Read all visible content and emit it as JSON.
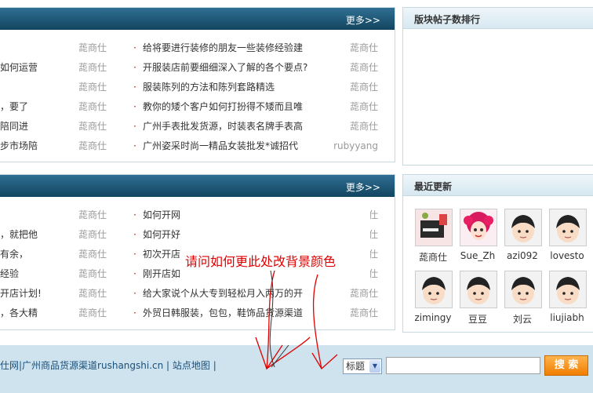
{
  "top_panel": {
    "more_label": "更多>>",
    "rows": [
      {
        "left_text": "",
        "left_author": "蒊商仕",
        "title": "给将要进行装修的朋友一些装修经验建",
        "author": "蒊商仕"
      },
      {
        "left_text": "如何运营",
        "left_author": "蒊商仕",
        "title": "开服装店前要细细深入了解的各个要点?",
        "author": "蒊商仕"
      },
      {
        "left_text": "",
        "left_author": "蒊商仕",
        "title": "服装陈列的方法和陈列套路精选",
        "author": "蒊商仕"
      },
      {
        "left_text": "，要了",
        "left_author": "蒊商仕",
        "title": "教你的矮个客户如何打扮得不矮而且唯",
        "author": "蒊商仕"
      },
      {
        "left_text": "陪同进",
        "left_author": "蒊商仕",
        "title": "广州手表批发货源，时装表名牌手表高",
        "author": "蒊商仕"
      },
      {
        "left_text": "步市场陪",
        "left_author": "蒊商仕",
        "title": "广州姿采时尚一精品女装批发*诚招代",
        "author": "rubyyang"
      }
    ]
  },
  "bottom_panel": {
    "more_label": "更多>>",
    "rows": [
      {
        "left_text": "",
        "left_author": "蒊商仕",
        "title": "如何开网",
        "author": "仕"
      },
      {
        "left_text": "，就把他",
        "left_author": "蒊商仕",
        "title": "如何开好",
        "author": "仕"
      },
      {
        "left_text": "有余，",
        "left_author": "蒊商仕",
        "title": "初次开店",
        "author": "仕"
      },
      {
        "left_text": "经验",
        "left_author": "蒊商仕",
        "title": "刚开店如",
        "author": "仕"
      },
      {
        "left_text": "开店计划!",
        "left_author": "蒊商仕",
        "title": "给大家说个从大专到轻松月入两万的开",
        "author": "蒊商仕"
      },
      {
        "left_text": "，各大精",
        "left_author": "蒊商仕",
        "title": "外贸日韩服装，包包，鞋饰品货源渠道",
        "author": "蒊商仕"
      }
    ]
  },
  "ranking_panel": {
    "title": "版块帖子数排行"
  },
  "recent_panel": {
    "title": "最近更新",
    "users": [
      {
        "name": "蒊商仕",
        "avatar": "photo-avatar"
      },
      {
        "name": "Sue_Zh",
        "avatar": "cartoon-girl-avatar"
      },
      {
        "name": "azi092",
        "avatar": "default-avatar"
      },
      {
        "name": "lovesto",
        "avatar": "default-avatar"
      },
      {
        "name": "zimingy",
        "avatar": "default-avatar"
      },
      {
        "name": "豆豆",
        "avatar": "default-avatar"
      },
      {
        "name": "刘云",
        "avatar": "default-avatar"
      },
      {
        "name": "liujiabh",
        "avatar": "default-avatar"
      }
    ]
  },
  "footer": {
    "links_text": "仕网|广州商品货源渠道rushangshi.cn  |  站点地图  |",
    "select_value": "标题",
    "search_button": "搜 索"
  },
  "annotation": {
    "text": "请问如何更此处改背景颜色"
  },
  "colors": {
    "header_dark": "#1a4f6e",
    "accent_red": "#e00000",
    "footer_bg": "#cfe3ee",
    "button_orange": "#f07d00"
  }
}
